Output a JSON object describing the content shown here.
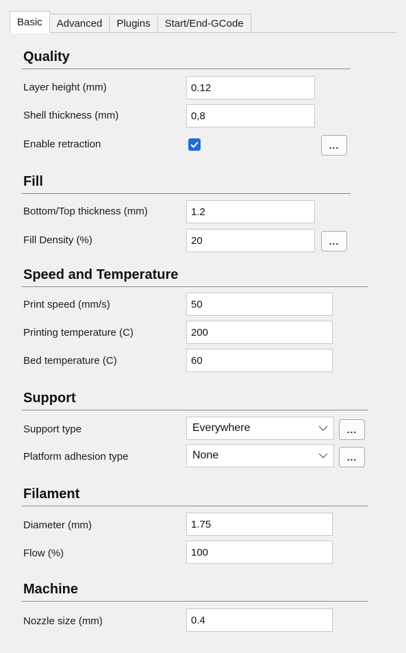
{
  "tabs": [
    {
      "label": "Basic",
      "active": true
    },
    {
      "label": "Advanced",
      "active": false
    },
    {
      "label": "Plugins",
      "active": false
    },
    {
      "label": "Start/End-GCode",
      "active": false
    }
  ],
  "quality": {
    "title": "Quality",
    "layer_height": {
      "label": "Layer height (mm)",
      "value": "0.12"
    },
    "shell_thickness": {
      "label": "Shell thickness (mm)",
      "value": "0,8"
    },
    "enable_retraction": {
      "label": "Enable retraction",
      "checked": true,
      "button": "..."
    }
  },
  "fill": {
    "title": "Fill",
    "bottom_top": {
      "label": "Bottom/Top thickness (mm)",
      "value": "1.2"
    },
    "fill_density": {
      "label": "Fill Density (%)",
      "value": "20",
      "button": "..."
    }
  },
  "speed": {
    "title": "Speed and Temperature",
    "print_speed": {
      "label": "Print speed (mm/s)",
      "value": "50"
    },
    "print_temp": {
      "label": "Printing temperature (C)",
      "value": "200"
    },
    "bed_temp": {
      "label": "Bed temperature (C)",
      "value": "60"
    }
  },
  "support": {
    "title": "Support",
    "support_type": {
      "label": "Support type",
      "value": "Everywhere",
      "button": "..."
    },
    "adhesion": {
      "label": "Platform adhesion type",
      "value": "None",
      "button": "..."
    }
  },
  "filament": {
    "title": "Filament",
    "diameter": {
      "label": "Diameter (mm)",
      "value": "1.75"
    },
    "flow": {
      "label": "Flow (%)",
      "value": "100"
    }
  },
  "machine": {
    "title": "Machine",
    "nozzle": {
      "label": "Nozzle size (mm)",
      "value": "0.4"
    }
  },
  "colors": {
    "checkbox": "#1f6bd6",
    "rule": "#8a8a8a"
  }
}
